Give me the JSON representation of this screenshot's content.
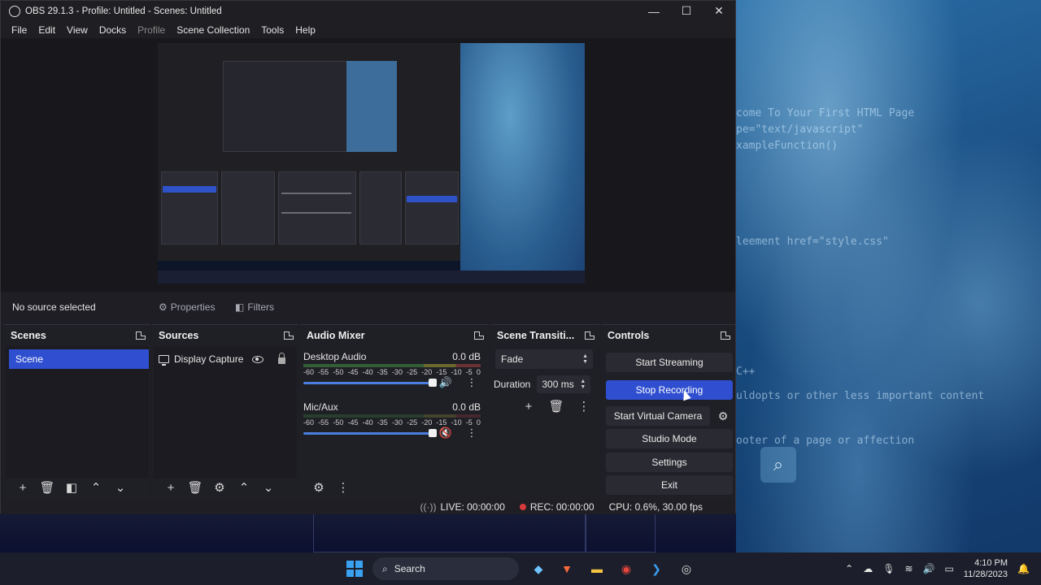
{
  "window": {
    "title": "OBS 29.1.3 - Profile: Untitled - Scenes: Untitled",
    "controls": {
      "minimize": "—",
      "maximize": "☐",
      "close": "✕"
    }
  },
  "menu": [
    "File",
    "Edit",
    "View",
    "Docks",
    "Profile",
    "Scene Collection",
    "Tools",
    "Help"
  ],
  "source_bar": {
    "status": "No source selected",
    "properties_label": "Properties",
    "filters_label": "Filters"
  },
  "docks": {
    "scenes": {
      "title": "Scenes",
      "items": [
        "Scene"
      ]
    },
    "sources": {
      "title": "Sources",
      "items": [
        "Display Capture"
      ]
    },
    "audio_mixer": {
      "title": "Audio Mixer",
      "ticks": [
        "-60",
        "-55",
        "-50",
        "-45",
        "-40",
        "-35",
        "-30",
        "-25",
        "-20",
        "-15",
        "-10",
        "-5",
        "0"
      ],
      "channels": [
        {
          "name": "Desktop Audio",
          "db": "0.0 dB",
          "muted": false,
          "volume": 1.0
        },
        {
          "name": "Mic/Aux",
          "db": "0.0 dB",
          "muted": true,
          "volume": 1.0
        }
      ]
    },
    "scene_transitions": {
      "title": "Scene Transiti...",
      "transition": "Fade",
      "duration_label": "Duration",
      "duration_value": "300 ms"
    },
    "controls": {
      "title": "Controls",
      "start_streaming": "Start Streaming",
      "stop_recording": "Stop Recording",
      "start_virtual_camera": "Start Virtual Camera",
      "studio_mode": "Studio Mode",
      "settings": "Settings",
      "exit": "Exit"
    }
  },
  "status": {
    "live": "LIVE: 00:00:00",
    "rec": "REC: 00:00:00",
    "cpu": "CPU: 0.6%, 30.00 fps"
  },
  "taskbar": {
    "search_label": "Search",
    "time": "4:10 PM",
    "date": "11/28/2023"
  },
  "colors": {
    "accent": "#2f4fd0",
    "panel": "#1f1f26",
    "rec": "#d63a3a"
  }
}
